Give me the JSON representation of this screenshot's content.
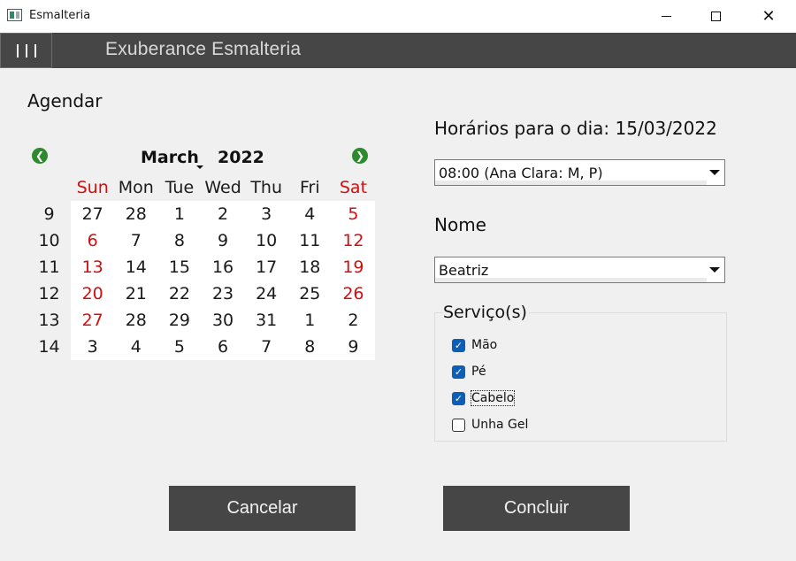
{
  "window": {
    "title": "Esmalteria",
    "controls": {
      "minimize": "—",
      "maximize": "☐",
      "close": "✕"
    }
  },
  "appbar": {
    "title": "Exuberance Esmalteria"
  },
  "schedule": {
    "heading": "Agendar",
    "calendar": {
      "month": "March",
      "year": "2022",
      "weekdays": [
        "Sun",
        "Mon",
        "Tue",
        "Wed",
        "Thu",
        "Fri",
        "Sat"
      ],
      "rows": [
        {
          "week": "9",
          "days": [
            "27",
            "28",
            "1",
            "2",
            "3",
            "4",
            "5"
          ]
        },
        {
          "week": "10",
          "days": [
            "6",
            "7",
            "8",
            "9",
            "10",
            "11",
            "12"
          ]
        },
        {
          "week": "11",
          "days": [
            "13",
            "14",
            "15",
            "16",
            "17",
            "18",
            "19"
          ]
        },
        {
          "week": "12",
          "days": [
            "20",
            "21",
            "22",
            "23",
            "24",
            "25",
            "26"
          ]
        },
        {
          "week": "13",
          "days": [
            "27",
            "28",
            "29",
            "30",
            "31",
            "1",
            "2"
          ]
        },
        {
          "week": "14",
          "days": [
            "3",
            "4",
            "5",
            "6",
            "7",
            "8",
            "9"
          ]
        }
      ],
      "weekend_color": "#d01010",
      "nav_color": "#2e8a2e"
    }
  },
  "times": {
    "heading": "Horários para o dia: 15/03/2022",
    "selected": "08:00 (Ana Clara: M, P)"
  },
  "name": {
    "heading": "Nome",
    "selected": "Beatriz"
  },
  "services": {
    "legend": "Serviço(s)",
    "items": [
      {
        "label": "Mão",
        "checked": true
      },
      {
        "label": "Pé",
        "checked": true
      },
      {
        "label": "Cabelo",
        "checked": true
      },
      {
        "label": "Unha Gel",
        "checked": false
      }
    ],
    "check_color": "#0d5fb5"
  },
  "actions": {
    "cancel": "Cancelar",
    "confirm": "Concluir"
  }
}
